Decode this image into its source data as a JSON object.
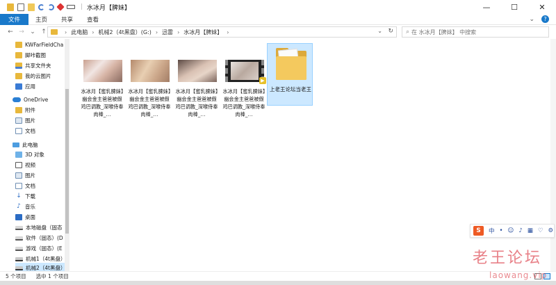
{
  "window": {
    "title": "水冰月【脾妹】",
    "controls": {
      "minimize": "—",
      "maximize": "☐",
      "close": "✕"
    }
  },
  "ribbon": {
    "tabs": [
      "文件",
      "主页",
      "共享",
      "查看"
    ],
    "expand_glyph": "⌄",
    "help_glyph": "?"
  },
  "address": {
    "breadcrumbs": [
      "此电脑",
      "机械2（4t黑盘）(G:)",
      "迅雷",
      "水冰月【脾妹】"
    ],
    "separator": "›",
    "dropdown_glyph": "⌄",
    "refresh_glyph": "↻"
  },
  "search": {
    "placeholder": "在 水冰月【脾妹】 中搜索",
    "glyph": "⌕"
  },
  "nav_buttons": {
    "back": "←",
    "forward": "→",
    "recent": "⌄",
    "up": "↑"
  },
  "nav_pane": {
    "items": [
      {
        "label": "KWFarFieldCha",
        "icon": "folder"
      },
      {
        "label": "脚咔截图",
        "icon": "folder"
      },
      {
        "label": "共享文件夹",
        "icon": "share"
      },
      {
        "label": "我的云图片",
        "icon": "folder"
      },
      {
        "label": "应用",
        "icon": "grid"
      },
      {
        "label": "OneDrive",
        "icon": "cloud"
      },
      {
        "label": "附件",
        "icon": "folder"
      },
      {
        "label": "图片",
        "icon": "img"
      },
      {
        "label": "文档",
        "icon": "doc"
      },
      {
        "label": "此电脑",
        "icon": "pc"
      },
      {
        "label": "3D 对象",
        "icon": "cube"
      },
      {
        "label": "视频",
        "icon": "video"
      },
      {
        "label": "图片",
        "icon": "img"
      },
      {
        "label": "文档",
        "icon": "doc"
      },
      {
        "label": "下载",
        "icon": "down"
      },
      {
        "label": "音乐",
        "icon": "music"
      },
      {
        "label": "桌面",
        "icon": "desk"
      },
      {
        "label": "本地磁盘（固态",
        "icon": "drive"
      },
      {
        "label": "软件（固态）(D",
        "icon": "drive"
      },
      {
        "label": "游戏（固态）(E",
        "icon": "drive"
      },
      {
        "label": "机械1（4t黑盘）",
        "icon": "drive-ext"
      },
      {
        "label": "机械2（4t黑盘）",
        "icon": "drive-ext"
      }
    ]
  },
  "files": [
    {
      "name": "水冰月【蜜乳脾妹】幽会金主爸爸被假鸡巴调教_深喉侍奉肉棒_…"
    },
    {
      "name": "水冰月【蜜乳脾妹】幽会金主爸爸被假鸡巴调教_深喉侍奉肉棒_…"
    },
    {
      "name": "水冰月【蜜乳脾妹】幽会金主爸爸被假鸡巴调教_深喉侍奉肉棒_…"
    },
    {
      "name": "水冰月【蜜乳脾妹】幽会金主爸爸被假鸡巴调教_深喉侍奉肉棒_…"
    }
  ],
  "folder": {
    "name": "上老王论坛当老王"
  },
  "status": {
    "count": "5 个项目",
    "selected": "选中 1 个项目"
  },
  "ime": {
    "logo": "S",
    "items": [
      "中",
      "•",
      "☺",
      "♪",
      "▦",
      "♡",
      "⚙"
    ]
  },
  "watermark": {
    "chinese": "老王论坛",
    "url": "laowang.vip"
  }
}
